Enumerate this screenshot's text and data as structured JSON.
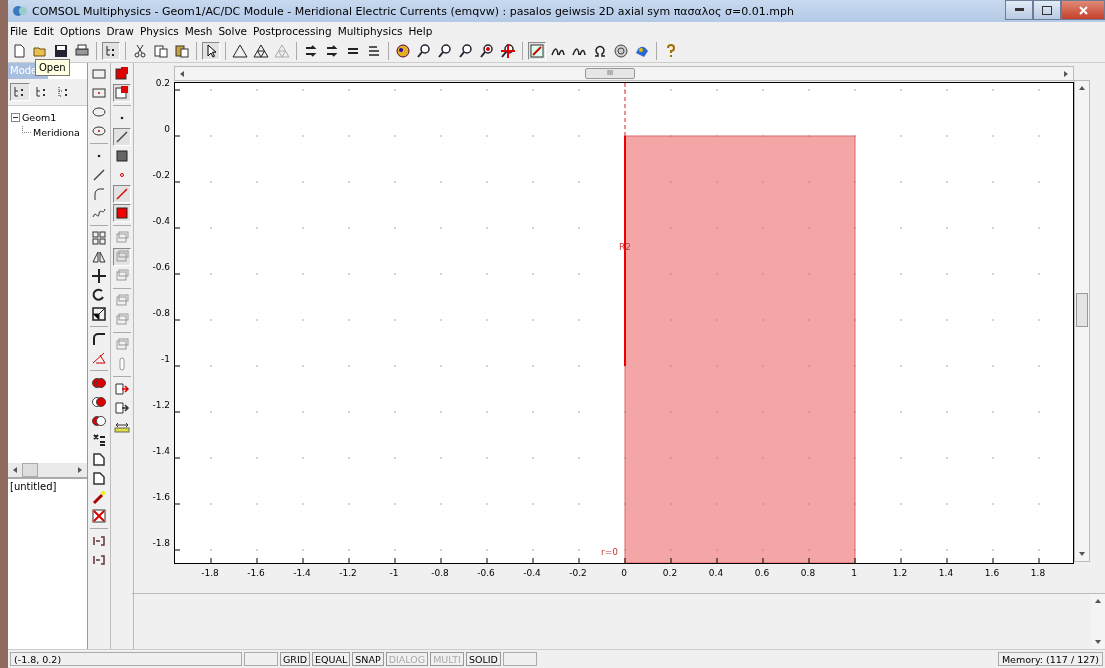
{
  "window": {
    "title": "COMSOL Multiphysics - Geom1/AC/DC Module - Meridional Electric Currents (emqvw) : pasalos geiwsis 2D axial sym πασαλος σ=0.01.mph"
  },
  "menu": [
    "File",
    "Edit",
    "Options",
    "Draw",
    "Physics",
    "Mesh",
    "Solve",
    "Postprocessing",
    "Multiphysics",
    "Help"
  ],
  "toolbar": [
    {
      "kind": "new",
      "pressed": false
    },
    {
      "kind": "open",
      "pressed": false
    },
    {
      "kind": "save",
      "pressed": false
    },
    {
      "kind": "print",
      "pressed": false
    },
    {
      "kind": "sep"
    },
    {
      "kind": "tree",
      "pressed": true
    },
    {
      "kind": "sep"
    },
    {
      "kind": "cut",
      "pressed": false
    },
    {
      "kind": "copy",
      "pressed": false
    },
    {
      "kind": "paste",
      "pressed": false
    },
    {
      "kind": "sep"
    },
    {
      "kind": "pointer",
      "pressed": true
    },
    {
      "kind": "sep"
    },
    {
      "kind": "triangle",
      "pressed": false
    },
    {
      "kind": "mesh",
      "pressed": false
    },
    {
      "kind": "refine",
      "pressed": false
    },
    {
      "kind": "sep"
    },
    {
      "kind": "subdomain",
      "pressed": false
    },
    {
      "kind": "boundary",
      "pressed": false
    },
    {
      "kind": "equal",
      "pressed": false
    },
    {
      "kind": "edge",
      "pressed": false
    },
    {
      "kind": "sep"
    },
    {
      "kind": "solve",
      "pressed": false
    },
    {
      "kind": "zoomin",
      "pressed": false
    },
    {
      "kind": "zoomout",
      "pressed": false
    },
    {
      "kind": "zoombox",
      "pressed": false
    },
    {
      "kind": "zoomsel",
      "pressed": false
    },
    {
      "kind": "zoomext",
      "pressed": false
    },
    {
      "kind": "sep"
    },
    {
      "kind": "draw",
      "pressed": true
    },
    {
      "kind": "scalar",
      "pressed": false
    },
    {
      "kind": "vector",
      "pressed": false
    },
    {
      "kind": "omega",
      "pressed": false
    },
    {
      "kind": "sphere",
      "pressed": false
    },
    {
      "kind": "plot",
      "pressed": false
    },
    {
      "kind": "sep"
    },
    {
      "kind": "help",
      "pressed": false
    }
  ],
  "tooltip": "Open",
  "model_tree": {
    "title": "Mode",
    "tabs": [
      {
        "selected": true
      },
      {
        "selected": false
      },
      {
        "selected": false
      }
    ],
    "items": [
      {
        "label": "Geom1",
        "expanded": true,
        "children": [
          {
            "label": "Meridiona"
          }
        ]
      }
    ],
    "file": "[untitled]"
  },
  "draw_toolbar_left": [
    {
      "kind": "rect",
      "pressed": false
    },
    {
      "kind": "rectc",
      "pressed": false
    },
    {
      "kind": "ellipse",
      "pressed": false
    },
    {
      "kind": "ellipsec",
      "pressed": false
    },
    {
      "kind": "sep"
    },
    {
      "kind": "point",
      "pressed": false
    },
    {
      "kind": "line",
      "pressed": false
    },
    {
      "kind": "arc",
      "pressed": false
    },
    {
      "kind": "curve",
      "pressed": false
    },
    {
      "kind": "sep"
    },
    {
      "kind": "array",
      "pressed": false
    },
    {
      "kind": "mirror",
      "pressed": false
    },
    {
      "kind": "move",
      "pressed": false
    },
    {
      "kind": "rotate",
      "pressed": false
    },
    {
      "kind": "scale",
      "pressed": false
    },
    {
      "kind": "sep"
    },
    {
      "kind": "fillet",
      "pressed": false
    },
    {
      "kind": "tangent",
      "pressed": false
    },
    {
      "kind": "sep"
    },
    {
      "kind": "union",
      "pressed": false
    },
    {
      "kind": "intersect",
      "pressed": false
    },
    {
      "kind": "difference",
      "pressed": false
    },
    {
      "kind": "compose",
      "pressed": false
    },
    {
      "kind": "coerce",
      "pressed": false
    },
    {
      "kind": "split",
      "pressed": false
    },
    {
      "kind": "erase",
      "pressed": false
    },
    {
      "kind": "delete",
      "pressed": false
    },
    {
      "kind": "sep"
    },
    {
      "kind": "bracket",
      "pressed": false
    },
    {
      "kind": "bracket",
      "pressed": false
    }
  ],
  "draw_toolbar_right": [
    {
      "kind": "solidred",
      "pressed": false
    },
    {
      "kind": "solidsel",
      "pressed": true
    },
    {
      "kind": "sep"
    },
    {
      "kind": "point",
      "pressed": false
    },
    {
      "kind": "line",
      "pressed": true
    },
    {
      "kind": "square",
      "pressed": false
    },
    {
      "kind": "pointred",
      "pressed": false
    },
    {
      "kind": "linered",
      "pressed": true
    },
    {
      "kind": "squarered",
      "pressed": true
    },
    {
      "kind": "sep"
    },
    {
      "kind": "box",
      "pressed": false
    },
    {
      "kind": "box",
      "pressed": true
    },
    {
      "kind": "box",
      "pressed": false
    },
    {
      "kind": "sep"
    },
    {
      "kind": "all",
      "pressed": false
    },
    {
      "kind": "none",
      "pressed": false
    },
    {
      "kind": "sep"
    },
    {
      "kind": "box",
      "pressed": false
    },
    {
      "kind": "thermo",
      "pressed": false
    },
    {
      "kind": "sep"
    },
    {
      "kind": "export",
      "pressed": false
    },
    {
      "kind": "import",
      "pressed": false
    },
    {
      "kind": "ruler",
      "pressed": false
    }
  ],
  "canvas": {
    "y_ticks": [
      "0.2",
      "0",
      "-0.2",
      "-0.4",
      "-0.6",
      "-0.8",
      "-1",
      "-1.2",
      "-1.4",
      "-1.6",
      "-1.8"
    ],
    "x_ticks": [
      "-1.8",
      "-1.6",
      "-1.4",
      "-1.2",
      "-1",
      "-0.8",
      "-0.6",
      "-0.4",
      "-0.2",
      "0",
      "0.2",
      "0.4",
      "0.6",
      "0.8",
      "1",
      "1.2",
      "1.4",
      "1.6",
      "1.8"
    ],
    "hscroll_grip": "III",
    "labels": [
      "R2",
      "r=0"
    ]
  },
  "status_bar": {
    "coords": "(-1.8, 0.2)",
    "toggles": [
      {
        "label": "GRID",
        "disabled": false
      },
      {
        "label": "EQUAL",
        "disabled": false
      },
      {
        "label": "SNAP",
        "disabled": false
      },
      {
        "label": "DIALOG",
        "disabled": true
      },
      {
        "label": "MULTI",
        "disabled": true
      },
      {
        "label": "SOLID",
        "disabled": false
      }
    ],
    "memory": "Memory: (117 / 127)"
  }
}
